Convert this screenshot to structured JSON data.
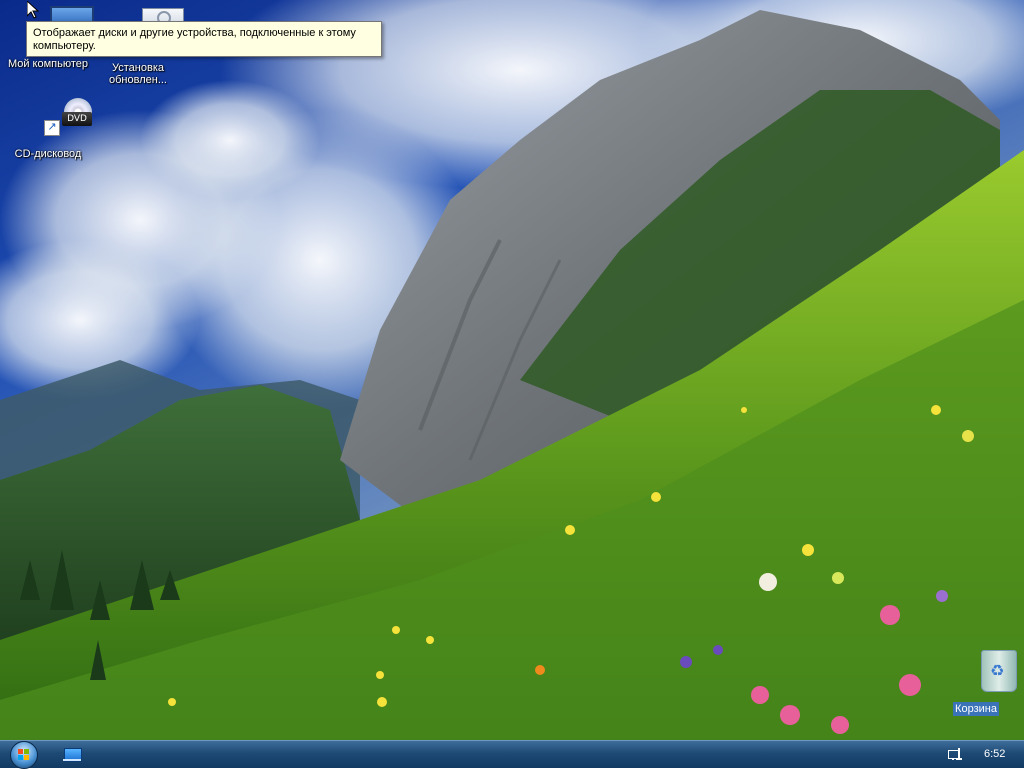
{
  "desktop": {
    "icons": [
      {
        "id": "my-computer",
        "label": "Мой компьютер"
      },
      {
        "id": "updates",
        "label": "Установка обновлен..."
      },
      {
        "id": "cd-drive",
        "label": "CD-дисковод",
        "badge": "DVD"
      },
      {
        "id": "recycle-bin",
        "label": "Корзина"
      }
    ]
  },
  "tooltip": {
    "text": "Отображает диски и другие устройства, подключенные к этому компьютеру."
  },
  "taskbar": {
    "start_icon": "windows-flag-icon",
    "quick_launch_icon": "show-desktop-icon",
    "tray_icon": "network-icon",
    "clock": "6:52"
  },
  "colors": {
    "taskbar": "#1d4a75",
    "tooltip_bg": "#ffffe1",
    "selection": "#3b73b9"
  }
}
